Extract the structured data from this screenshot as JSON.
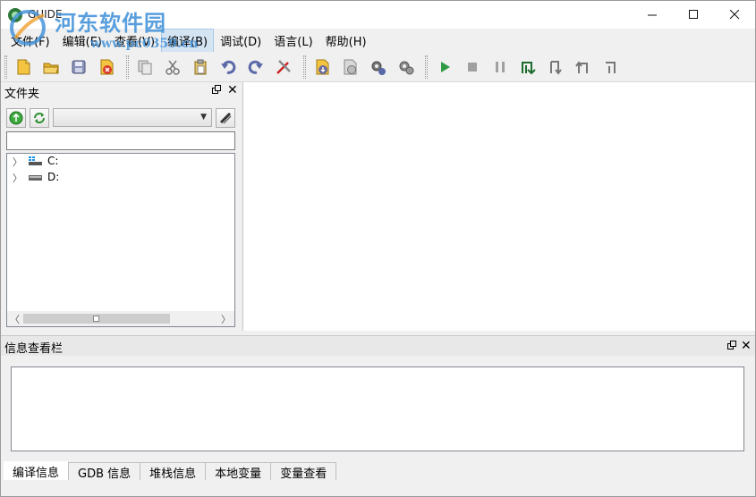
{
  "window": {
    "title": "GUIDE",
    "watermark_text": "河东软件园",
    "watermark_url": "www.pc0359.cn"
  },
  "menu": [
    "文件(F)",
    "编辑(E)",
    "查看(V)",
    "编译(B)",
    "调试(D)",
    "语言(L)",
    "帮助(H)"
  ],
  "left_pane": {
    "title": "文件夹",
    "path_value": "",
    "drives": [
      {
        "label": "C:",
        "icon": "windows-drive-icon"
      },
      {
        "label": "D:",
        "icon": "hard-drive-icon"
      }
    ]
  },
  "bottom_pane": {
    "title": "信息查看栏",
    "tabs": [
      "编译信息",
      "GDB 信息",
      "堆栈信息",
      "本地变量",
      "变量查看"
    ],
    "active_tab": "编译信息"
  },
  "colors": {
    "menu_active_bg": "#d5e4f3",
    "watermark": "#3d8fd8",
    "run_green": "#2f9b45"
  }
}
